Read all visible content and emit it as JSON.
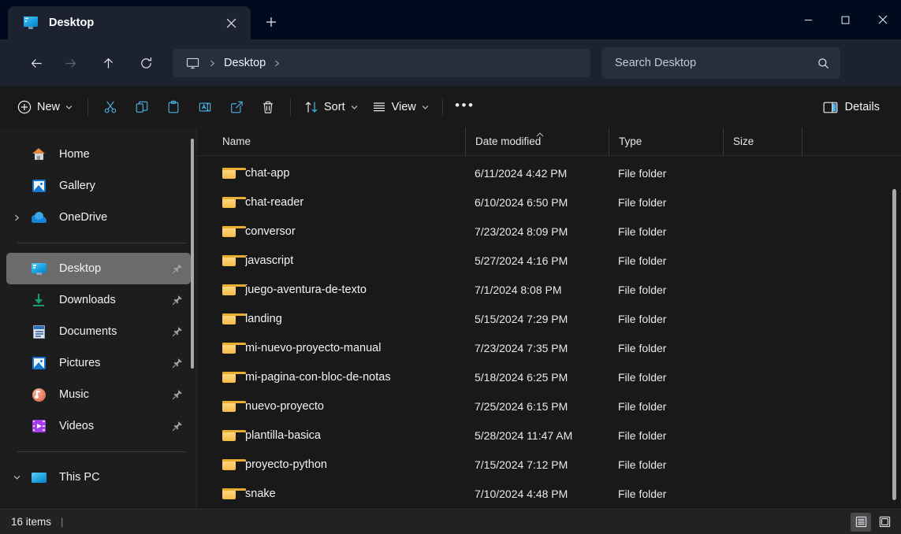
{
  "window": {
    "titlebar_color": "#000a1e",
    "accent_color": "#4cb3e8",
    "tabs": [
      {
        "label": "Desktop",
        "icon": "monitor-icon",
        "active": true
      }
    ],
    "new_tab_tooltip": "New tab",
    "controls": {
      "minimize": "minimize",
      "maximize": "maximize",
      "close": "close"
    }
  },
  "addressbar": {
    "back": "Back",
    "forward": "Forward",
    "up": "Up to parent",
    "refresh": "Refresh",
    "breadcrumb": {
      "root_icon": "monitor-icon",
      "segments": [
        "Desktop"
      ]
    },
    "search": {
      "placeholder": "Search Desktop",
      "value": "",
      "icon": "search-icon"
    }
  },
  "toolbar": {
    "new_label": "New",
    "cut_label": "Cut",
    "copy_label": "Copy",
    "paste_label": "Paste",
    "rename_label": "Rename",
    "share_label": "Share",
    "delete_label": "Delete",
    "sort_label": "Sort",
    "view_label": "View",
    "more_label": "See more",
    "details_label": "Details"
  },
  "sidebar": {
    "items": [
      {
        "label": "Home",
        "icon": "home-icon",
        "pinned": false,
        "expander": false,
        "selected": false
      },
      {
        "label": "Gallery",
        "icon": "gallery-icon",
        "pinned": false,
        "expander": false,
        "selected": false
      },
      {
        "label": "OneDrive",
        "icon": "cloud-icon",
        "pinned": false,
        "expander": true,
        "selected": false
      },
      {
        "label": "Desktop",
        "icon": "desktop-icon",
        "pinned": true,
        "expander": false,
        "selected": true
      },
      {
        "label": "Downloads",
        "icon": "download-icon",
        "pinned": true,
        "expander": false,
        "selected": false
      },
      {
        "label": "Documents",
        "icon": "document-icon",
        "pinned": true,
        "expander": false,
        "selected": false
      },
      {
        "label": "Pictures",
        "icon": "picture-icon",
        "pinned": true,
        "expander": false,
        "selected": false
      },
      {
        "label": "Music",
        "icon": "music-icon",
        "pinned": true,
        "expander": false,
        "selected": false
      },
      {
        "label": "Videos",
        "icon": "video-icon",
        "pinned": true,
        "expander": false,
        "selected": false
      },
      {
        "label": "This PC",
        "icon": "pc-icon",
        "pinned": false,
        "expander": true,
        "selected": false
      }
    ]
  },
  "filelist": {
    "columns": [
      "Name",
      "Date modified",
      "Type",
      "Size"
    ],
    "sort_column": "Name",
    "sort_direction": "ascending",
    "rows": [
      {
        "name": "chat-app",
        "date": "6/11/2024 4:42 PM",
        "type": "File folder",
        "size": ""
      },
      {
        "name": "chat-reader",
        "date": "6/10/2024 6:50 PM",
        "type": "File folder",
        "size": ""
      },
      {
        "name": "conversor",
        "date": "7/23/2024 8:09 PM",
        "type": "File folder",
        "size": ""
      },
      {
        "name": "javascript",
        "date": "5/27/2024 4:16 PM",
        "type": "File folder",
        "size": ""
      },
      {
        "name": "juego-aventura-de-texto",
        "date": "7/1/2024 8:08 PM",
        "type": "File folder",
        "size": ""
      },
      {
        "name": "landing",
        "date": "5/15/2024 7:29 PM",
        "type": "File folder",
        "size": ""
      },
      {
        "name": "mi-nuevo-proyecto-manual",
        "date": "7/23/2024 7:35 PM",
        "type": "File folder",
        "size": ""
      },
      {
        "name": "mi-pagina-con-bloc-de-notas",
        "date": "5/18/2024 6:25 PM",
        "type": "File folder",
        "size": ""
      },
      {
        "name": "nuevo-proyecto",
        "date": "7/25/2024 6:15 PM",
        "type": "File folder",
        "size": ""
      },
      {
        "name": "plantilla-basica",
        "date": "5/28/2024 11:47 AM",
        "type": "File folder",
        "size": ""
      },
      {
        "name": "proyecto-python",
        "date": "7/15/2024 7:12 PM",
        "type": "File folder",
        "size": ""
      },
      {
        "name": "snake",
        "date": "7/10/2024 4:48 PM",
        "type": "File folder",
        "size": ""
      }
    ]
  },
  "statusbar": {
    "item_count": "16 items",
    "separator": "|",
    "details_view_label": "Details view",
    "large_icons_view_label": "Large icons view"
  }
}
